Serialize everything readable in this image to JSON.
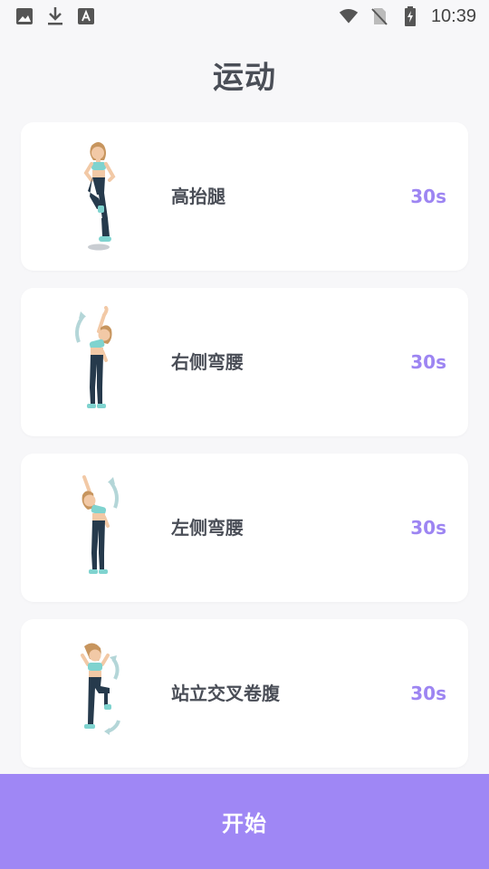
{
  "status_bar": {
    "time": "10:39",
    "left_icons": [
      "image-icon",
      "download-icon",
      "font-icon"
    ],
    "right_icons": [
      "wifi-icon",
      "no-sim-icon",
      "battery-charging-icon"
    ]
  },
  "page": {
    "title": "运动"
  },
  "exercises": [
    {
      "name": "高抬腿",
      "duration": "30s",
      "figure_icon": "high-knee-figure"
    },
    {
      "name": "右侧弯腰",
      "duration": "30s",
      "figure_icon": "right-side-bend-figure"
    },
    {
      "name": "左侧弯腰",
      "duration": "30s",
      "figure_icon": "left-side-bend-figure"
    },
    {
      "name": "站立交叉卷腹",
      "duration": "30s",
      "figure_icon": "standing-cross-crunch-figure"
    }
  ],
  "start_button": {
    "label": "开始"
  },
  "colors": {
    "accent": "#9f87f5",
    "duration_text": "#9d85f2",
    "title_text": "#4a4e57",
    "background": "#f7f7f9",
    "card": "#ffffff"
  }
}
